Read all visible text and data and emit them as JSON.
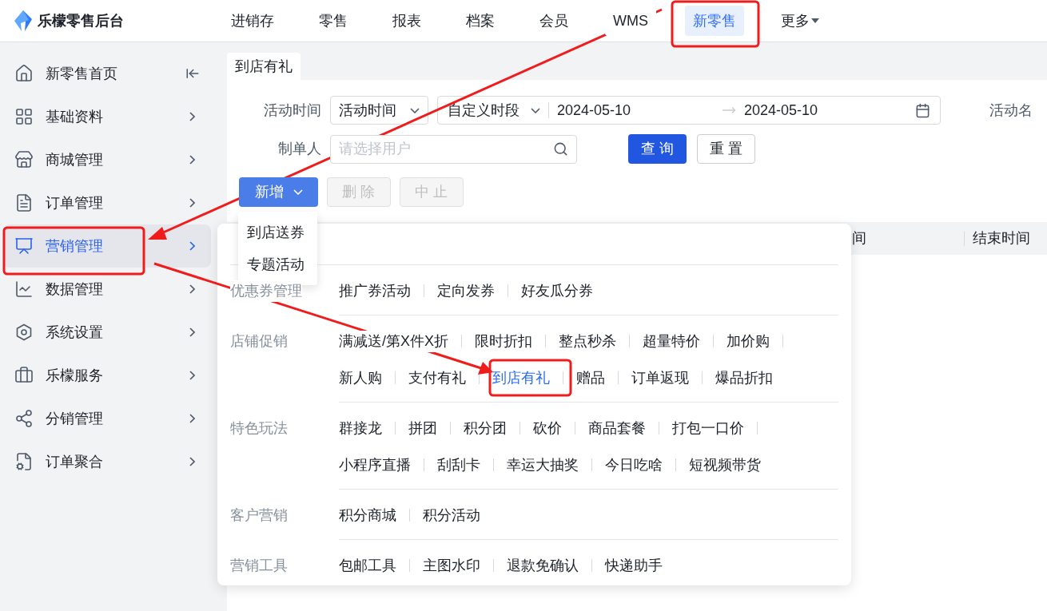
{
  "brand": {
    "name": "乐檬零售后台"
  },
  "top_nav": [
    {
      "label": "进销存",
      "selected": false,
      "kind": "link"
    },
    {
      "label": "零售",
      "selected": false,
      "kind": "link"
    },
    {
      "label": "报表",
      "selected": false,
      "kind": "link"
    },
    {
      "label": "档案",
      "selected": false,
      "kind": "link"
    },
    {
      "label": "会员",
      "selected": false,
      "kind": "link"
    },
    {
      "label": "WMS",
      "selected": false,
      "kind": "link"
    },
    {
      "label": "新零售",
      "selected": true,
      "kind": "link"
    },
    {
      "label": "更多",
      "selected": false,
      "kind": "menu"
    }
  ],
  "sidebar": {
    "items": [
      {
        "label": "新零售首页",
        "selected": false,
        "kind": "home"
      },
      {
        "label": "基础资料",
        "selected": false,
        "kind": "group"
      },
      {
        "label": "商城管理",
        "selected": false,
        "kind": "group"
      },
      {
        "label": "订单管理",
        "selected": false,
        "kind": "group"
      },
      {
        "label": "营销管理",
        "selected": true,
        "kind": "group"
      },
      {
        "label": "数据管理",
        "selected": false,
        "kind": "group"
      },
      {
        "label": "系统设置",
        "selected": false,
        "kind": "group"
      },
      {
        "label": "乐檬服务",
        "selected": false,
        "kind": "group"
      },
      {
        "label": "分销管理",
        "selected": false,
        "kind": "group"
      },
      {
        "label": "订单聚合",
        "selected": false,
        "kind": "group"
      }
    ]
  },
  "page_tab": {
    "label": "到店有礼"
  },
  "filters": {
    "activity_time": {
      "label": "活动时间",
      "type_select": "活动时间",
      "period_select": "自定义时段",
      "start": "2024-05-10",
      "end": "2024-05-10"
    },
    "activity_name": {
      "label": "活动名"
    },
    "creator": {
      "label": "制单人",
      "placeholder": "请选择用户"
    },
    "query_button": "查 询",
    "reset_button": "重 置"
  },
  "toolbar": [
    {
      "label": "新增",
      "disabled": false,
      "menu": [
        "到店送券",
        "专题活动"
      ]
    },
    {
      "label": "删 除",
      "disabled": true
    },
    {
      "label": "中 止",
      "disabled": true
    }
  ],
  "table": {
    "columns": [
      "间",
      "结束时间"
    ]
  },
  "flyout": {
    "sections": [
      {
        "label": "优惠券管理",
        "items": [
          {
            "label": "推广券活动",
            "selected": false
          },
          {
            "label": "定向发券",
            "selected": false
          },
          {
            "label": "好友瓜分券",
            "selected": false
          }
        ]
      },
      {
        "label": "店铺促销",
        "items": [
          {
            "label": "满减送/第X件X折",
            "selected": false
          },
          {
            "label": "限时折扣",
            "selected": false
          },
          {
            "label": "整点秒杀",
            "selected": false
          },
          {
            "label": "超量特价",
            "selected": false
          },
          {
            "label": "加价购",
            "selected": false
          },
          {
            "label": "新人购",
            "selected": false
          },
          {
            "label": "支付有礼",
            "selected": false
          },
          {
            "label": "到店有礼",
            "selected": true
          },
          {
            "label": "赠品",
            "selected": false
          },
          {
            "label": "订单返现",
            "selected": false
          },
          {
            "label": "爆品折扣",
            "selected": false
          }
        ]
      },
      {
        "label": "特色玩法",
        "items": [
          {
            "label": "群接龙",
            "selected": false
          },
          {
            "label": "拼团",
            "selected": false
          },
          {
            "label": "积分团",
            "selected": false
          },
          {
            "label": "砍价",
            "selected": false
          },
          {
            "label": "商品套餐",
            "selected": false
          },
          {
            "label": "打包一口价",
            "selected": false
          },
          {
            "label": "小程序直播",
            "selected": false
          },
          {
            "label": "刮刮卡",
            "selected": false
          },
          {
            "label": "幸运大抽奖",
            "selected": false
          },
          {
            "label": "今日吃啥",
            "selected": false
          },
          {
            "label": "短视频带货",
            "selected": false
          }
        ]
      },
      {
        "label": "客户营销",
        "items": [
          {
            "label": "积分商城",
            "selected": false
          },
          {
            "label": "积分活动",
            "selected": false
          }
        ]
      },
      {
        "label": "营销工具",
        "items": [
          {
            "label": "包邮工具",
            "selected": false
          },
          {
            "label": "主图水印",
            "selected": false
          },
          {
            "label": "退款免确认",
            "selected": false
          },
          {
            "label": "快递助手",
            "selected": false
          }
        ]
      }
    ]
  }
}
